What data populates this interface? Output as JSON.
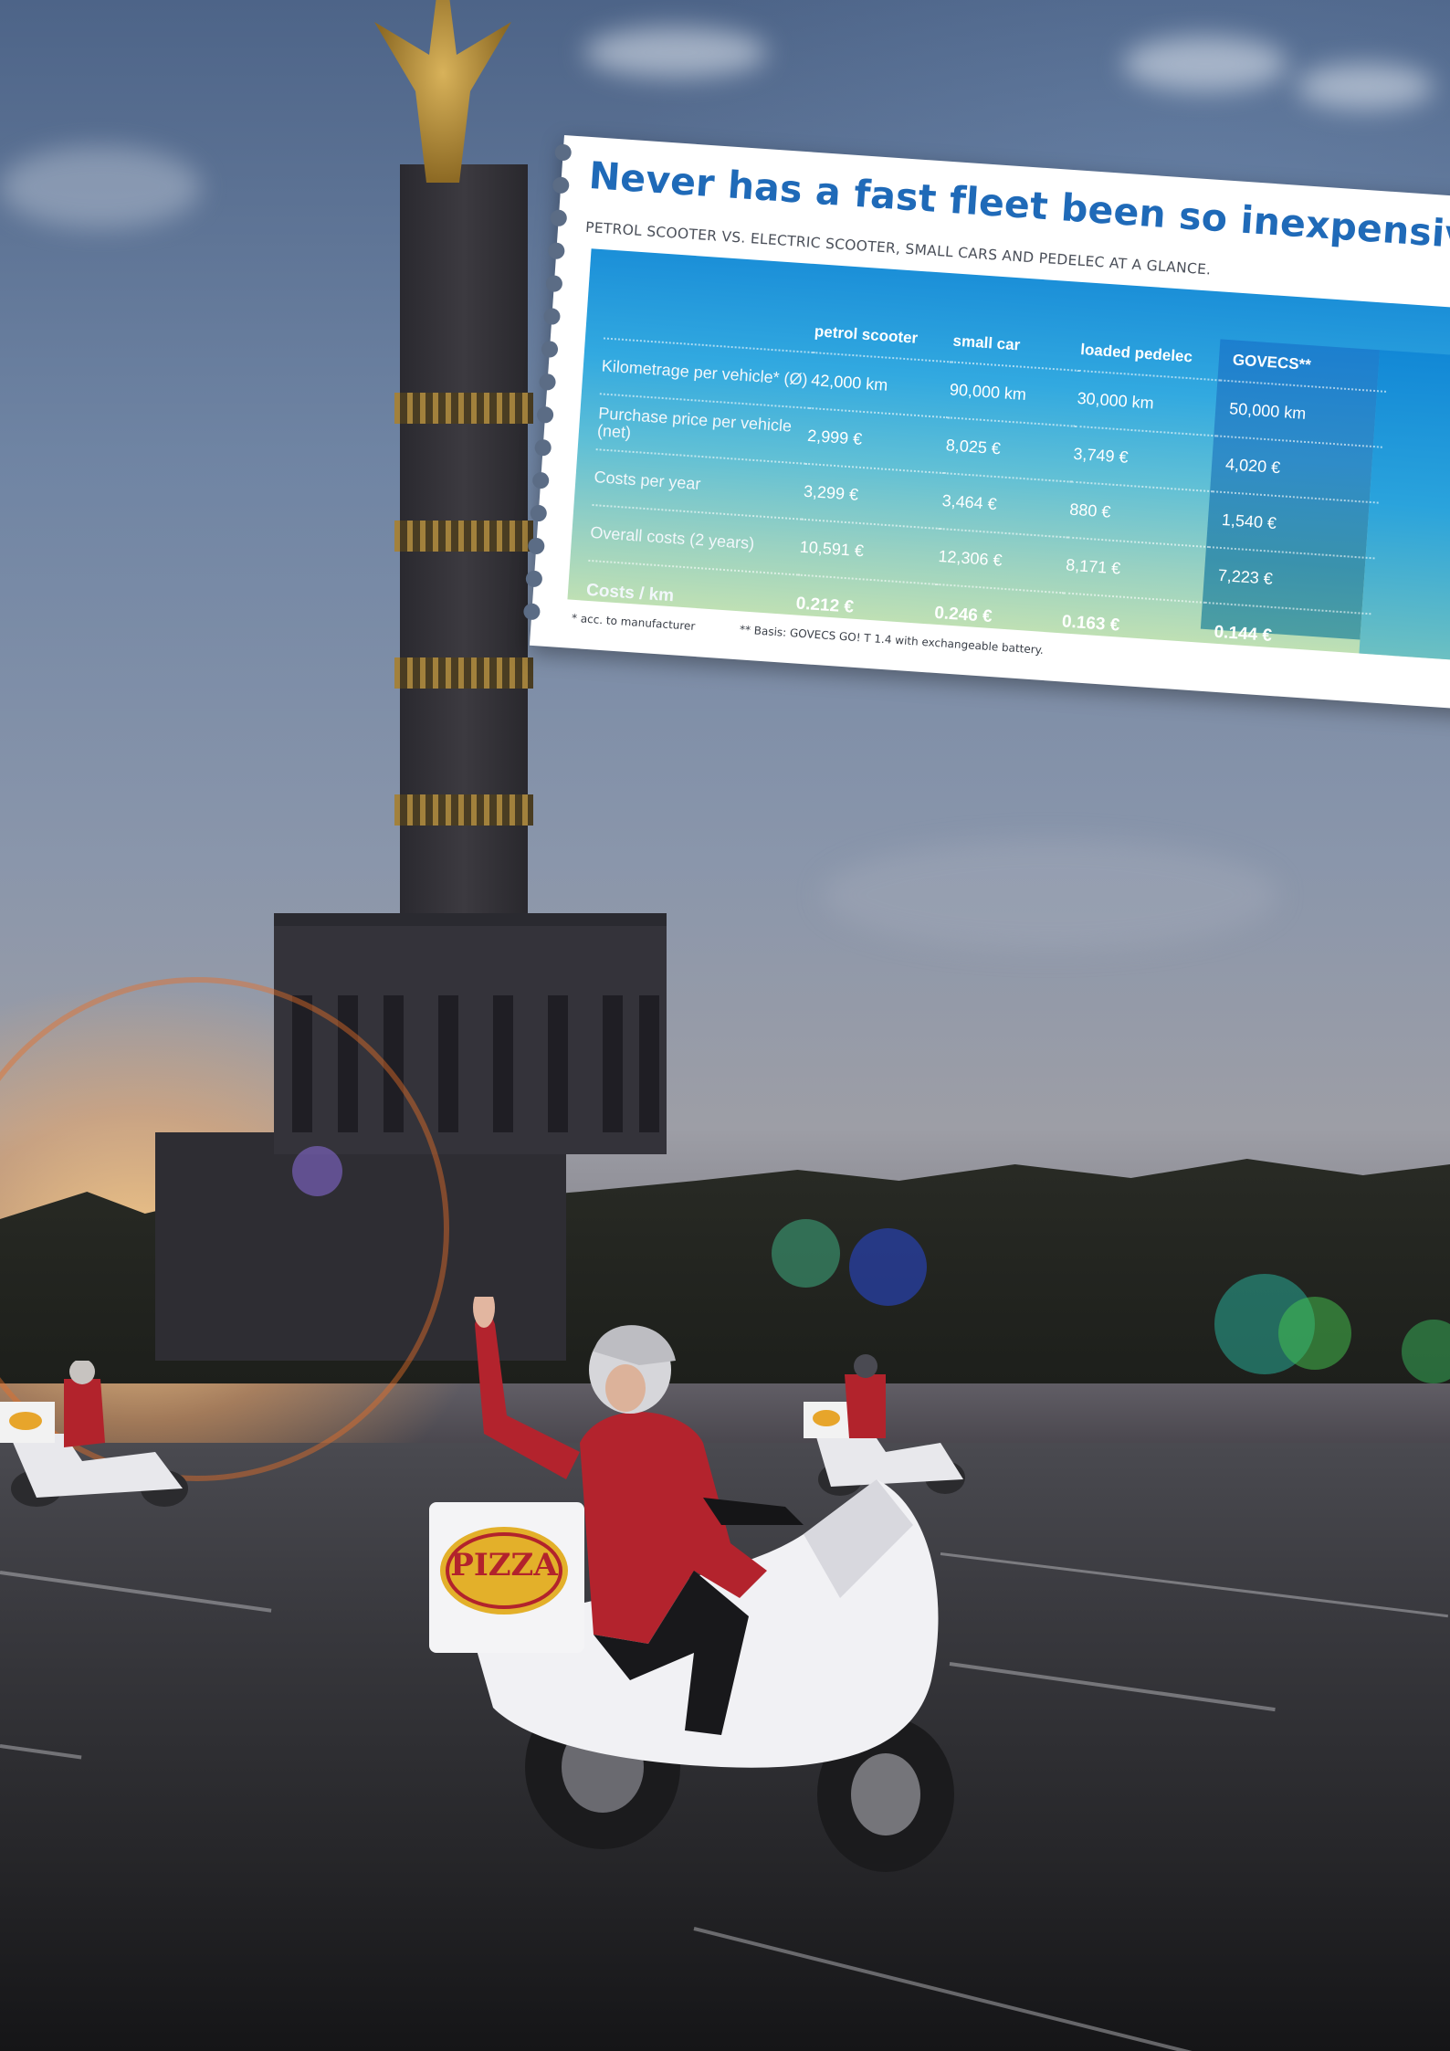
{
  "card": {
    "title": "Never has a fast fleet been so inexpensive!",
    "subtitle": "PETROL SCOOTER  VS. ELECTRIC SCOOTER, SMALL CARS AND PEDELEC AT A GLANCE.",
    "table": {
      "columns": [
        "",
        "petrol scooter",
        "small car",
        "loaded pedelec",
        "GOVECS**"
      ],
      "rows": [
        {
          "label": "Kilometrage per vehicle* (Ø)",
          "values": [
            "42,000 km",
            "90,000 km",
            "30,000 km",
            "50,000 km"
          ]
        },
        {
          "label": "Purchase price per vehicle (net)",
          "values": [
            "2,999 €",
            "8,025 €",
            "3,749 €",
            "4,020 €"
          ]
        },
        {
          "label": "Costs per year",
          "values": [
            "3,299 €",
            "3,464 €",
            "880 €",
            "1,540 €"
          ]
        },
        {
          "label": "Overall costs (2 years)",
          "values": [
            "10,591 €",
            "12,306 €",
            "8,171 €",
            "7,223 €"
          ]
        },
        {
          "label": "Costs / km",
          "values": [
            "0.212 €",
            "0.246 €",
            "0.163 €",
            "0.144 €"
          ]
        }
      ]
    },
    "footnotes": {
      "a": "* acc. to manufacturer",
      "b": "** Basis: GOVECS GO! T 1.4 with exchangeable battery."
    }
  },
  "photo": {
    "scooter_box_label": "PIZZA"
  }
}
